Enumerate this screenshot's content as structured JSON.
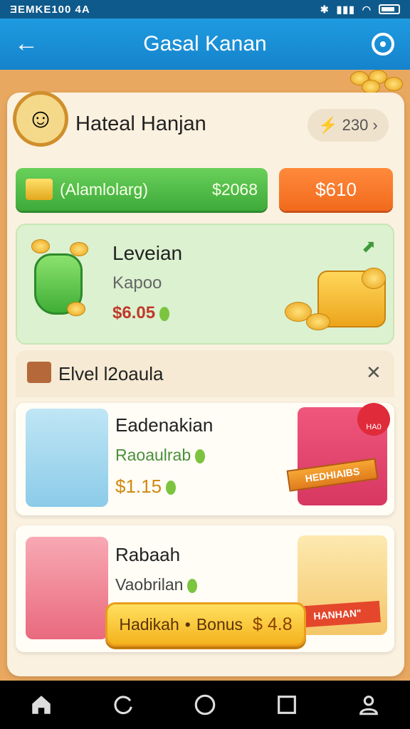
{
  "status_bar": {
    "left_text": "ƎEMKE100 4A",
    "icons": [
      "bluetooth-icon",
      "signal-icon",
      "wifi-icon",
      "battery-icon"
    ]
  },
  "app_bar": {
    "title": "Gasal Kanan",
    "back_icon": "arrow-left-icon",
    "settings_icon": "target-icon"
  },
  "profile": {
    "name": "Hateal Hanjan",
    "balance": "230",
    "balance_icon": "bolt-icon"
  },
  "wallet": {
    "label": "(Alamlolarg)",
    "amount": "$2068",
    "action_label": "$610"
  },
  "featured": {
    "title": "Leveian",
    "subtitle": "Kapoo",
    "price": "$6.05"
  },
  "section": {
    "title": "Elvel l2oaula"
  },
  "items": [
    {
      "title": "Eadenakian",
      "subtitle": "Raoaulrab",
      "price": "$1.15",
      "badge": "HA0",
      "ribbon": "HEDHIAIBS"
    },
    {
      "title": "Rabaah",
      "subtitle": "Vaobrilan",
      "ribbon": "HANHAN\""
    }
  ],
  "bonus": {
    "left": "Hadikah",
    "sep": "•",
    "label": "Bonus",
    "amount": "$ 4.8"
  },
  "nav": [
    {
      "icon": "home-icon"
    },
    {
      "icon": "refresh-icon"
    },
    {
      "icon": "circle-icon"
    },
    {
      "icon": "square-icon"
    },
    {
      "icon": "profile-icon"
    }
  ],
  "colors": {
    "app_bar": "#1683cc",
    "green": "#3daa3a",
    "orange": "#f26a1c",
    "gold": "#f4b31d"
  }
}
